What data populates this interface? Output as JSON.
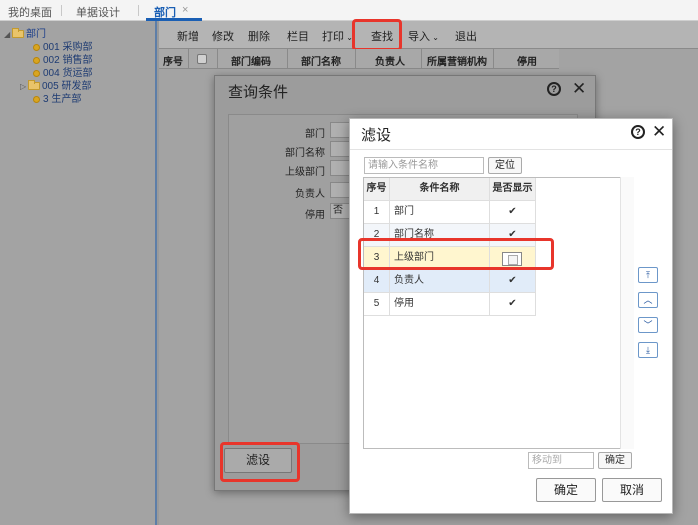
{
  "top_tabs": {
    "desktop": "我的桌面",
    "doc_design": "单据设计",
    "dept": "部门",
    "close": "×"
  },
  "tree": {
    "root": "部门",
    "items": [
      "001 采购部",
      "002 销售部",
      "004 货运部",
      "005 研发部",
      "3 生产部"
    ]
  },
  "toolbar": {
    "add": "新增",
    "edit": "修改",
    "delete": "删除",
    "columns": "栏目",
    "print": "打印",
    "find": "查找",
    "import": "导入",
    "exit": "退出"
  },
  "columns": [
    "序号",
    "部门编码",
    "部门名称",
    "负责人",
    "所属营销机构",
    "停用"
  ],
  "query_dialog": {
    "title": "查询条件",
    "fields": {
      "dept": "部门",
      "dept_name": "部门名称",
      "parent_dept": "上级部门",
      "manager": "负责人",
      "disabled": "停用",
      "disabled_value": "否"
    },
    "filter_button": "滤设"
  },
  "filter_dialog": {
    "title": "滤设",
    "search_placeholder": "请输入条件名称",
    "locate_button": "定位",
    "headers": {
      "no": "序号",
      "name": "条件名称",
      "show": "是否显示"
    },
    "rows": [
      {
        "no": "1",
        "name": "部门",
        "show": "✔"
      },
      {
        "no": "2",
        "name": "部门名称",
        "show": "✔"
      },
      {
        "no": "3",
        "name": "上级部门",
        "show": ""
      },
      {
        "no": "4",
        "name": "负责人",
        "show": "✔"
      },
      {
        "no": "5",
        "name": "停用",
        "show": "✔"
      }
    ],
    "move_to_placeholder": "移动到",
    "move_ok": "确定",
    "ok": "确定",
    "cancel": "取消"
  },
  "colors": {
    "accent_blue": "#1a5fb4",
    "highlight_red": "#e8352b"
  }
}
